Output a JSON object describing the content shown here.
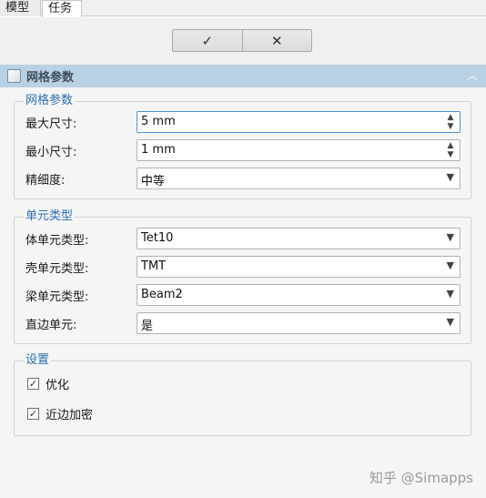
{
  "tabs": [
    {
      "label": "模型"
    },
    {
      "label": "任务"
    }
  ],
  "actions": {
    "ok_icon": "check-icon",
    "cancel_icon": "close-icon",
    "ok_glyph": "✓",
    "cancel_glyph": "✕"
  },
  "section": {
    "title": "网格参数",
    "collapse_glyph": "︿"
  },
  "mesh_params": {
    "legend": "网格参数",
    "max_size": {
      "label": "最大尺寸:",
      "value": "5 mm"
    },
    "min_size": {
      "label": "最小尺寸:",
      "value": "1 mm"
    },
    "fineness": {
      "label": "精细度:",
      "value": "中等"
    }
  },
  "element_types": {
    "legend": "单元类型",
    "solid": {
      "label": "体单元类型:",
      "value": "Tet10"
    },
    "shell": {
      "label": "壳单元类型:",
      "value": "TMT"
    },
    "beam": {
      "label": "梁单元类型:",
      "value": "Beam2"
    },
    "straight": {
      "label": "直边单元:",
      "value": "是"
    }
  },
  "settings": {
    "legend": "设置",
    "optimize": {
      "label": "优化",
      "checked": true
    },
    "near_refine": {
      "label": "近边加密",
      "checked": true
    }
  },
  "watermark": "知乎 @Simapps",
  "colors": {
    "header_bg": "#b9d1e4",
    "legend_text": "#2a6fb3",
    "focus_border": "#4a90d9"
  }
}
